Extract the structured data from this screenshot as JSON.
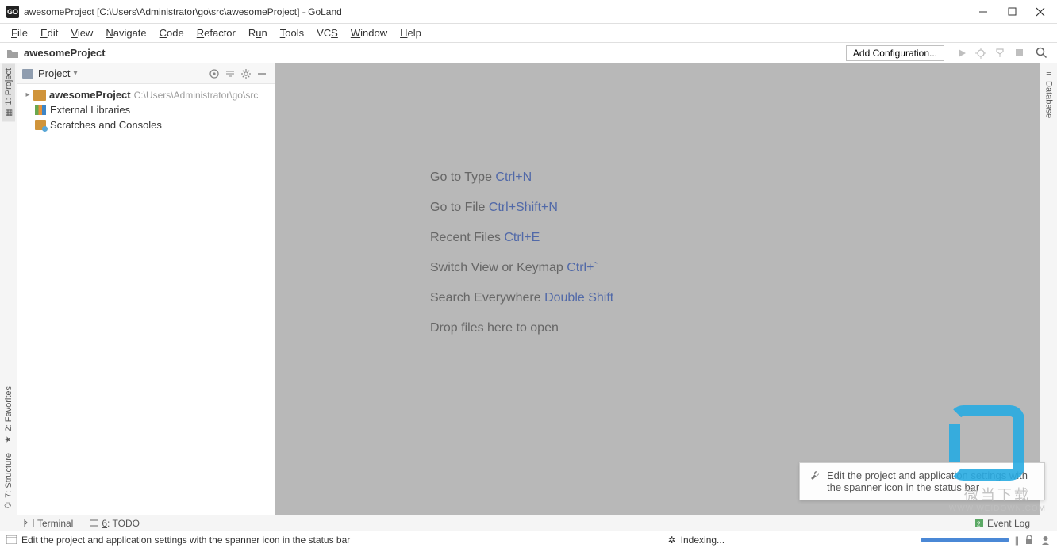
{
  "titlebar": {
    "title": "awesomeProject [C:\\Users\\Administrator\\go\\src\\awesomeProject] - GoLand",
    "app_icon": "GO"
  },
  "menu": [
    "File",
    "Edit",
    "View",
    "Navigate",
    "Code",
    "Refactor",
    "Run",
    "Tools",
    "VCS",
    "Window",
    "Help"
  ],
  "navbar": {
    "crumb": "awesomeProject",
    "add_config": "Add Configuration..."
  },
  "left_tabs": [
    {
      "label": "1: Project",
      "icon": "project"
    },
    {
      "label": "2: Favorites",
      "icon": "star"
    },
    {
      "label": "7: Structure",
      "icon": "structure"
    }
  ],
  "right_tabs": [
    {
      "label": "Database",
      "icon": "database"
    }
  ],
  "project_panel": {
    "title": "Project",
    "root": {
      "name": "awesomeProject",
      "path": "C:\\Users\\Administrator\\go\\src"
    },
    "external": "External Libraries",
    "scratches": "Scratches and Consoles"
  },
  "hints": [
    {
      "label": "Go to Type ",
      "shortcut": "Ctrl+N"
    },
    {
      "label": "Go to File ",
      "shortcut": "Ctrl+Shift+N"
    },
    {
      "label": "Recent Files ",
      "shortcut": "Ctrl+E"
    },
    {
      "label": "Switch View or Keymap ",
      "shortcut": "Ctrl+`"
    },
    {
      "label": "Search Everywhere ",
      "shortcut": "Double Shift"
    },
    {
      "label": "Drop files here to open",
      "shortcut": ""
    }
  ],
  "bottom_tools": {
    "terminal": "Terminal",
    "todo": "6: TODO",
    "event_log": "Event Log"
  },
  "tooltip_text": "Edit the project and application settings with the spanner icon in the status bar",
  "statusbar": {
    "msg": "Edit the project and application settings with the spanner icon in the status bar",
    "indexing": "Indexing..."
  },
  "watermark": {
    "brand": "微当下载",
    "url": "WWW.WEIDOWN.COM"
  }
}
